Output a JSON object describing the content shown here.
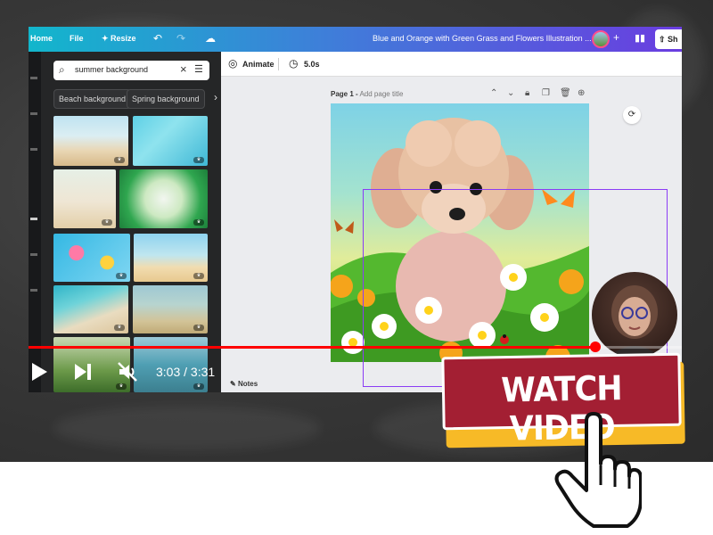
{
  "editor": {
    "topbar": {
      "home_label": "Home",
      "file_label": "File",
      "resize_label": "Resize",
      "document_title": "Blue and Orange with Green Grass and Flowers Illustration ...",
      "share_label": "Sh"
    },
    "toolbar": {
      "animate_label": "Animate",
      "duration_label": "5.0s"
    },
    "side_panel": {
      "search_value": "summer background",
      "suggestions": [
        "Beach background",
        "Spring background"
      ],
      "thumbnails": [
        "sandy beach",
        "water surface",
        "palm sand",
        "tropical leaves",
        "pool floats",
        "beach shore",
        "ocean wave",
        "sand beach",
        "green blur",
        "sea view"
      ]
    },
    "canvas": {
      "page_number_label": "Page 1 -",
      "page_title_placeholder": "Add page title",
      "notes_label": "Notes"
    }
  },
  "video_player": {
    "current_time": "3:03",
    "duration": "3:31",
    "time_display": "3:03 / 3:31",
    "progress_fraction": 0.867
  },
  "overlay": {
    "watch_video_label": "WATCH VIDEO",
    "button_color": "#a31f33",
    "shadow_color": "#f7ba27"
  }
}
